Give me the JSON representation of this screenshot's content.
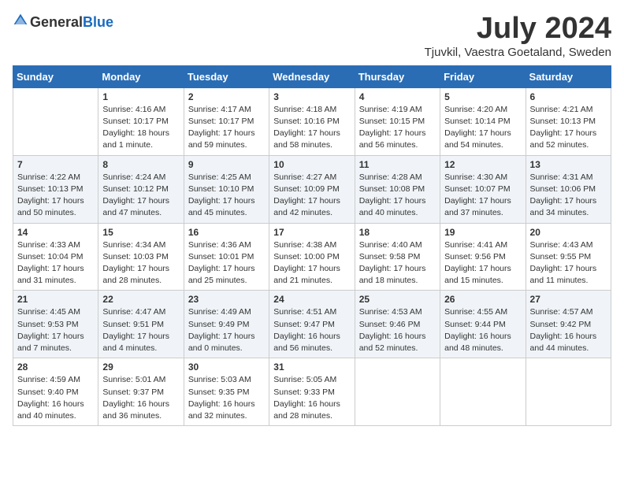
{
  "header": {
    "logo_general": "General",
    "logo_blue": "Blue",
    "month_year": "July 2024",
    "location": "Tjuvkil, Vaestra Goetaland, Sweden"
  },
  "days_of_week": [
    "Sunday",
    "Monday",
    "Tuesday",
    "Wednesday",
    "Thursday",
    "Friday",
    "Saturday"
  ],
  "weeks": [
    [
      {
        "day": "",
        "info": ""
      },
      {
        "day": "1",
        "info": "Sunrise: 4:16 AM\nSunset: 10:17 PM\nDaylight: 18 hours\nand 1 minute."
      },
      {
        "day": "2",
        "info": "Sunrise: 4:17 AM\nSunset: 10:17 PM\nDaylight: 17 hours\nand 59 minutes."
      },
      {
        "day": "3",
        "info": "Sunrise: 4:18 AM\nSunset: 10:16 PM\nDaylight: 17 hours\nand 58 minutes."
      },
      {
        "day": "4",
        "info": "Sunrise: 4:19 AM\nSunset: 10:15 PM\nDaylight: 17 hours\nand 56 minutes."
      },
      {
        "day": "5",
        "info": "Sunrise: 4:20 AM\nSunset: 10:14 PM\nDaylight: 17 hours\nand 54 minutes."
      },
      {
        "day": "6",
        "info": "Sunrise: 4:21 AM\nSunset: 10:13 PM\nDaylight: 17 hours\nand 52 minutes."
      }
    ],
    [
      {
        "day": "7",
        "info": "Sunrise: 4:22 AM\nSunset: 10:13 PM\nDaylight: 17 hours\nand 50 minutes."
      },
      {
        "day": "8",
        "info": "Sunrise: 4:24 AM\nSunset: 10:12 PM\nDaylight: 17 hours\nand 47 minutes."
      },
      {
        "day": "9",
        "info": "Sunrise: 4:25 AM\nSunset: 10:10 PM\nDaylight: 17 hours\nand 45 minutes."
      },
      {
        "day": "10",
        "info": "Sunrise: 4:27 AM\nSunset: 10:09 PM\nDaylight: 17 hours\nand 42 minutes."
      },
      {
        "day": "11",
        "info": "Sunrise: 4:28 AM\nSunset: 10:08 PM\nDaylight: 17 hours\nand 40 minutes."
      },
      {
        "day": "12",
        "info": "Sunrise: 4:30 AM\nSunset: 10:07 PM\nDaylight: 17 hours\nand 37 minutes."
      },
      {
        "day": "13",
        "info": "Sunrise: 4:31 AM\nSunset: 10:06 PM\nDaylight: 17 hours\nand 34 minutes."
      }
    ],
    [
      {
        "day": "14",
        "info": "Sunrise: 4:33 AM\nSunset: 10:04 PM\nDaylight: 17 hours\nand 31 minutes."
      },
      {
        "day": "15",
        "info": "Sunrise: 4:34 AM\nSunset: 10:03 PM\nDaylight: 17 hours\nand 28 minutes."
      },
      {
        "day": "16",
        "info": "Sunrise: 4:36 AM\nSunset: 10:01 PM\nDaylight: 17 hours\nand 25 minutes."
      },
      {
        "day": "17",
        "info": "Sunrise: 4:38 AM\nSunset: 10:00 PM\nDaylight: 17 hours\nand 21 minutes."
      },
      {
        "day": "18",
        "info": "Sunrise: 4:40 AM\nSunset: 9:58 PM\nDaylight: 17 hours\nand 18 minutes."
      },
      {
        "day": "19",
        "info": "Sunrise: 4:41 AM\nSunset: 9:56 PM\nDaylight: 17 hours\nand 15 minutes."
      },
      {
        "day": "20",
        "info": "Sunrise: 4:43 AM\nSunset: 9:55 PM\nDaylight: 17 hours\nand 11 minutes."
      }
    ],
    [
      {
        "day": "21",
        "info": "Sunrise: 4:45 AM\nSunset: 9:53 PM\nDaylight: 17 hours\nand 7 minutes."
      },
      {
        "day": "22",
        "info": "Sunrise: 4:47 AM\nSunset: 9:51 PM\nDaylight: 17 hours\nand 4 minutes."
      },
      {
        "day": "23",
        "info": "Sunrise: 4:49 AM\nSunset: 9:49 PM\nDaylight: 17 hours\nand 0 minutes."
      },
      {
        "day": "24",
        "info": "Sunrise: 4:51 AM\nSunset: 9:47 PM\nDaylight: 16 hours\nand 56 minutes."
      },
      {
        "day": "25",
        "info": "Sunrise: 4:53 AM\nSunset: 9:46 PM\nDaylight: 16 hours\nand 52 minutes."
      },
      {
        "day": "26",
        "info": "Sunrise: 4:55 AM\nSunset: 9:44 PM\nDaylight: 16 hours\nand 48 minutes."
      },
      {
        "day": "27",
        "info": "Sunrise: 4:57 AM\nSunset: 9:42 PM\nDaylight: 16 hours\nand 44 minutes."
      }
    ],
    [
      {
        "day": "28",
        "info": "Sunrise: 4:59 AM\nSunset: 9:40 PM\nDaylight: 16 hours\nand 40 minutes."
      },
      {
        "day": "29",
        "info": "Sunrise: 5:01 AM\nSunset: 9:37 PM\nDaylight: 16 hours\nand 36 minutes."
      },
      {
        "day": "30",
        "info": "Sunrise: 5:03 AM\nSunset: 9:35 PM\nDaylight: 16 hours\nand 32 minutes."
      },
      {
        "day": "31",
        "info": "Sunrise: 5:05 AM\nSunset: 9:33 PM\nDaylight: 16 hours\nand 28 minutes."
      },
      {
        "day": "",
        "info": ""
      },
      {
        "day": "",
        "info": ""
      },
      {
        "day": "",
        "info": ""
      }
    ]
  ]
}
